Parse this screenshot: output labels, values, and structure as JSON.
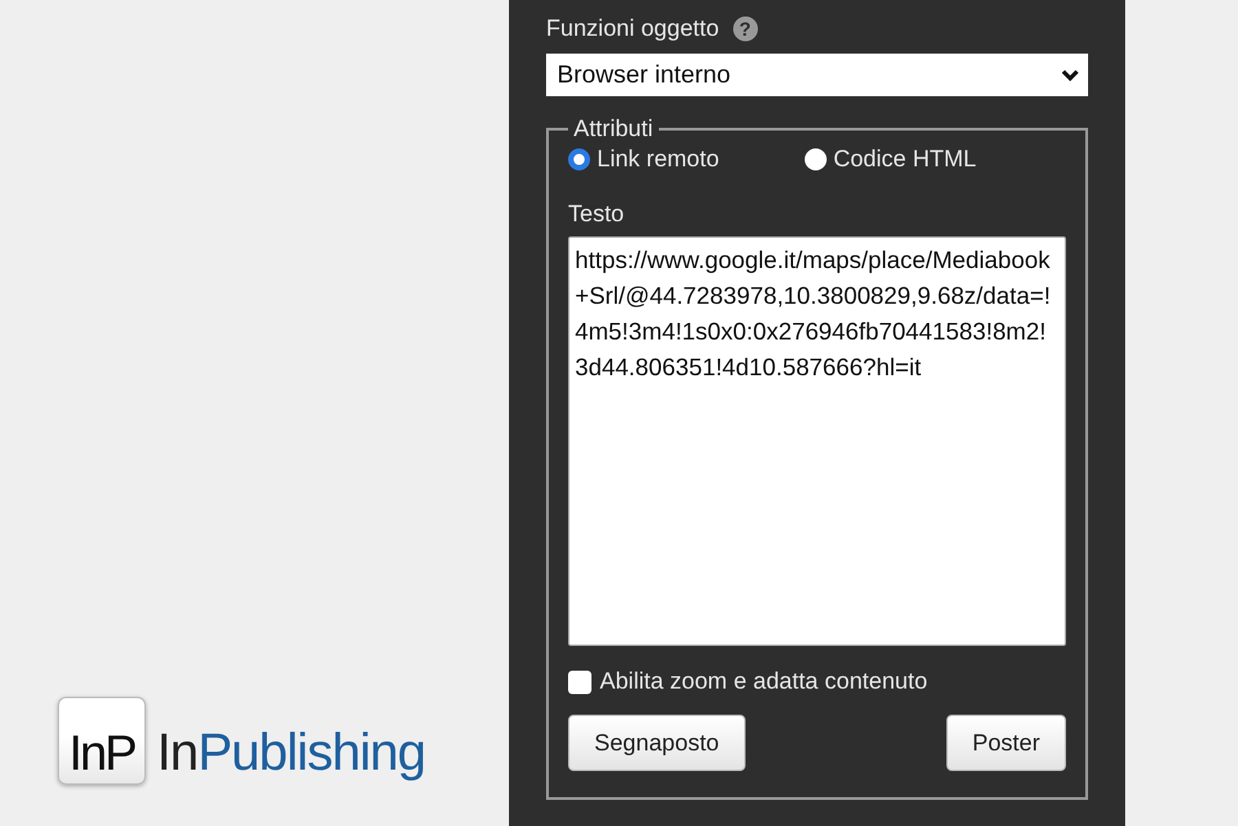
{
  "logo": {
    "icon_text": "InP",
    "wordmark_dark": "In",
    "wordmark_accent": "Publishing"
  },
  "panel": {
    "function_label": "Funzioni oggetto",
    "help": "?",
    "function_select": {
      "value": "Browser interno"
    },
    "attributes": {
      "legend": "Attributi",
      "modes": [
        {
          "label": "Link remoto",
          "selected": true
        },
        {
          "label": "Codice HTML",
          "selected": false
        }
      ],
      "text_label": "Testo",
      "text_value": "https://www.google.it/maps/place/Mediabook+Srl/@44.7283978,10.3800829,9.68z/data=!4m5!3m4!1s0x0:0x276946fb70441583!8m2!3d44.806351!4d10.587666?hl=it",
      "zoom_option": {
        "label": "Abilita zoom e adatta contenuto",
        "checked": false
      },
      "buttons": [
        "Segnaposto",
        "Poster"
      ]
    }
  }
}
